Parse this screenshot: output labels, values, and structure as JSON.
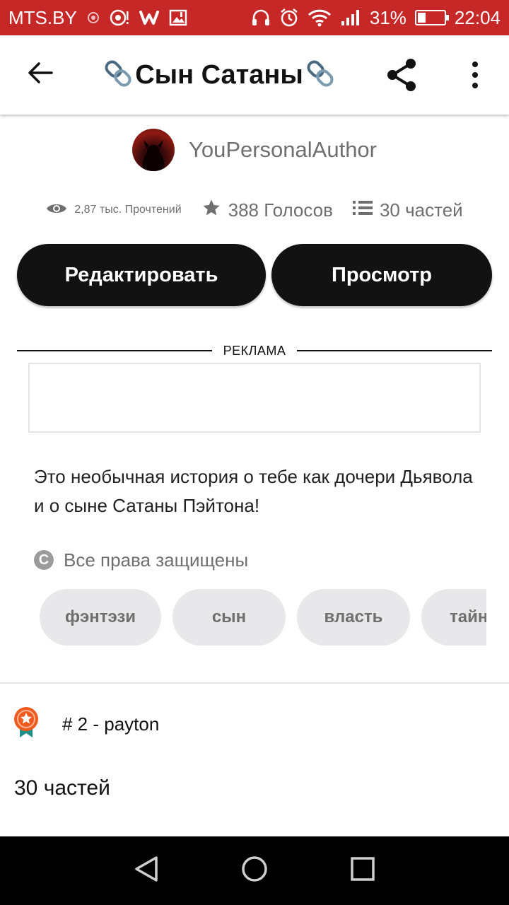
{
  "status_bar": {
    "carrier": "MTS.BY",
    "battery_percent_text": "31%",
    "battery_level": 0.31,
    "time": "22:04",
    "icons": [
      "notification-dot-icon",
      "hotspot-icon",
      "wattpad-icon",
      "image-icon",
      "headphones-icon",
      "alarm-icon",
      "wifi-icon",
      "signal-icon",
      "battery-icon"
    ]
  },
  "app_bar": {
    "title": "Сын Сатаны",
    "title_decoration_icon": "chain-link-icon",
    "back_icon": "arrow-back-icon",
    "share_icon": "share-icon",
    "more_icon": "more-vert-icon"
  },
  "author": {
    "name": "YouPersonalAuthor"
  },
  "stats": {
    "reads": "2,87 тыс. Прочтений",
    "votes": "388 Голосов",
    "parts": "30 частей"
  },
  "actions": {
    "edit_label": "Редактировать",
    "view_label": "Просмотр"
  },
  "ad": {
    "label": "РЕКЛАМА"
  },
  "description": "Это необычная история о тебе как дочери Дьявола и о сыне Сатаны Пэйтона!",
  "rights": {
    "text": "Все права защищены"
  },
  "tags": [
    "фэнтэзи",
    "сын",
    "власть",
    "тайн"
  ],
  "ranking": {
    "text": "# 2 - payton"
  },
  "parts_section": {
    "title": "30 частей"
  },
  "colors": {
    "status_bar": "#c62828",
    "button_bg": "#121212",
    "tag_bg": "#e8e7e9",
    "badge_orange": "#ef5a1f",
    "badge_teal": "#1f8f8a"
  }
}
